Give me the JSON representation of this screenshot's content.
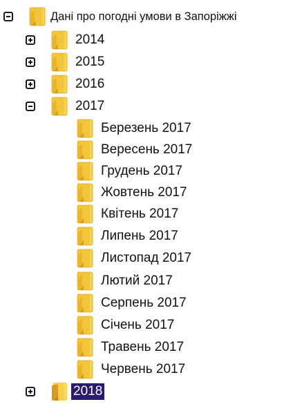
{
  "tree": {
    "root": {
      "label": "Дані про погодні умови в Запоріжжі",
      "expanded": true
    },
    "years": [
      {
        "label": "2014",
        "expanded": false,
        "selected": false
      },
      {
        "label": "2015",
        "expanded": false,
        "selected": false
      },
      {
        "label": "2016",
        "expanded": false,
        "selected": false
      },
      {
        "label": "2017",
        "expanded": true,
        "selected": false
      },
      {
        "label": "2018",
        "expanded": false,
        "selected": true
      }
    ],
    "months_2017": [
      "Березень 2017",
      "Вересень 2017",
      "Грудень 2017",
      "Жовтень 2017",
      "Квітень 2017",
      "Липень 2017",
      "Листопад 2017",
      "Лютий 2017",
      "Серпень 2017",
      "Січень 2017",
      "Травень 2017",
      "Червень 2017"
    ]
  },
  "colors": {
    "folder_fill": "#f3c63a",
    "folder_shade": "#d99b17",
    "selection_bg": "#2c1a6e",
    "selection_text": "#ffffff",
    "toggle_border": "#1b1b1b"
  }
}
